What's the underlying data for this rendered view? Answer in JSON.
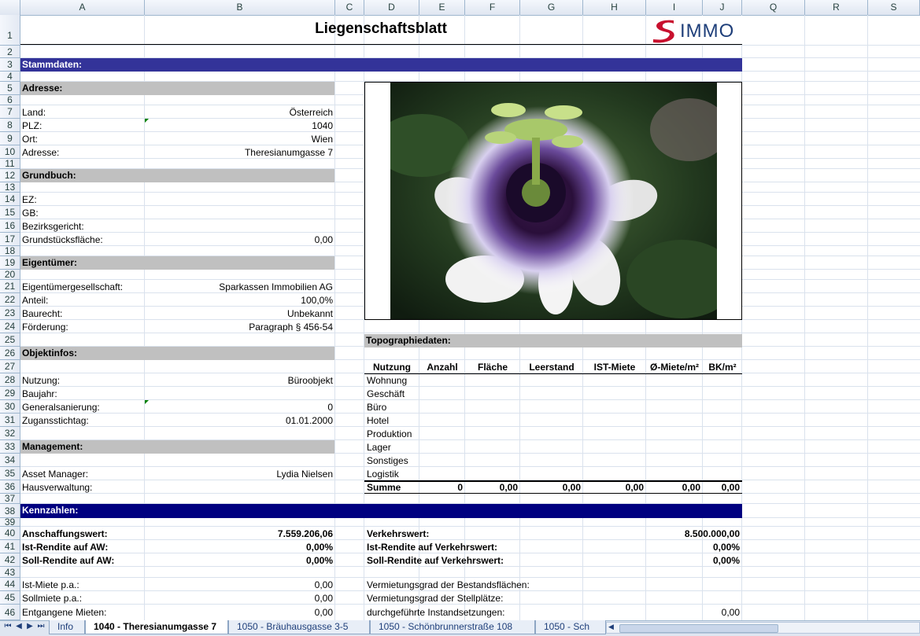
{
  "columns": [
    "A",
    "B",
    "C",
    "D",
    "E",
    "F",
    "G",
    "H",
    "I",
    "J",
    "Q",
    "R",
    "S"
  ],
  "rows": [
    "1",
    "2",
    "3",
    "4",
    "5",
    "6",
    "7",
    "8",
    "9",
    "10",
    "11",
    "12",
    "13",
    "14",
    "15",
    "16",
    "17",
    "18",
    "19",
    "20",
    "21",
    "22",
    "23",
    "24",
    "25",
    "26",
    "27",
    "28",
    "29",
    "30",
    "31",
    "32",
    "33",
    "34",
    "35",
    "36",
    "37",
    "38",
    "39",
    "40",
    "41",
    "42",
    "43",
    "44",
    "45",
    "46"
  ],
  "title": "Liegenschaftsblatt",
  "logo": {
    "text": "IMMO",
    "color_red": "#c8102e",
    "color_blue": "#1f3f7a"
  },
  "sections": {
    "stammdaten": "Stammdaten:",
    "adresse": "Adresse:",
    "grundbuch": "Grundbuch:",
    "eigentuemer": "Eigentümer:",
    "objektinfos": "Objektinfos:",
    "management": "Management:",
    "topographie": "Topographiedaten:",
    "kennzahlen": "Kennzahlen:"
  },
  "adresse": [
    {
      "label": "Land:",
      "value": "Österreich"
    },
    {
      "label": "PLZ:",
      "value": "1040"
    },
    {
      "label": "Ort:",
      "value": "Wien"
    },
    {
      "label": "Adresse:",
      "value": "Theresianumgasse 7"
    }
  ],
  "grundbuch": [
    {
      "label": "EZ:",
      "value": ""
    },
    {
      "label": "GB:",
      "value": ""
    },
    {
      "label": "Bezirksgericht:",
      "value": ""
    },
    {
      "label": "Grundstücksfläche:",
      "value": "0,00"
    }
  ],
  "eigentuemer": [
    {
      "label": "Eigentümergesellschaft:",
      "value": "Sparkassen Immobilien AG"
    },
    {
      "label": "Anteil:",
      "value": "100,0%"
    },
    {
      "label": "Baurecht:",
      "value": "Unbekannt"
    },
    {
      "label": "Förderung:",
      "value": "Paragraph § 456-54"
    }
  ],
  "objektinfos": [
    {
      "label": "Nutzung:",
      "value": "Büroobjekt"
    },
    {
      "label": "Baujahr:",
      "value": ""
    },
    {
      "label": "Generalsanierung:",
      "value": "0"
    },
    {
      "label": "Zugansstichtag:",
      "value": "01.01.2000"
    }
  ],
  "management": [
    {
      "label": "Asset Manager:",
      "value": "Lydia Nielsen"
    },
    {
      "label": "Hausverwaltung:",
      "value": ""
    }
  ],
  "topo": {
    "headers": [
      "Nutzung",
      "Anzahl",
      "Fläche",
      "Leerstand",
      "IST-Miete",
      "Ø-Miete/m²",
      "BK/m²"
    ],
    "rows": [
      "Wohnung",
      "Geschäft",
      "Büro",
      "Hotel",
      "Produktion",
      "Lager",
      "Sonstiges",
      "Logistik"
    ],
    "summe": {
      "label": "Summe",
      "values": [
        "0",
        "0,00",
        "0,00",
        "0,00",
        "0,00",
        "0,00"
      ]
    }
  },
  "kennzahlen_left": [
    {
      "label": "Anschaffungswert:",
      "value": "7.559.206,06",
      "bold": true
    },
    {
      "label": "Ist-Rendite auf AW:",
      "value": "0,00%",
      "bold": true
    },
    {
      "label": "Soll-Rendite auf AW:",
      "value": "0,00%",
      "bold": true
    },
    {
      "label": "Ist-Miete p.a.:",
      "value": "0,00",
      "bold": false
    },
    {
      "label": "Sollmiete p.a.:",
      "value": "0,00",
      "bold": false
    },
    {
      "label": "Entgangene Mieten:",
      "value": "0,00",
      "bold": false
    }
  ],
  "kennzahlen_right": [
    {
      "label": "Verkehrswert:",
      "value": "8.500.000,00",
      "bold": true
    },
    {
      "label": "Ist-Rendite auf Verkehrswert:",
      "value": "0,00%",
      "bold": true
    },
    {
      "label": "Soll-Rendite auf Verkehrswert:",
      "value": "0,00%",
      "bold": true
    },
    {
      "label": "Vermietungsgrad der Bestandsflächen:",
      "value": "",
      "bold": false
    },
    {
      "label": "Vermietungsgrad der Stellplätze:",
      "value": "",
      "bold": false
    },
    {
      "label": "durchgeführte Instandsetzungen:",
      "value": "0,00",
      "bold": false
    }
  ],
  "tabs": [
    "Info",
    "1040 - Theresianumgasse 7",
    "1050 - Bräuhausgasse 3-5",
    "1050 - Schönbrunnerstraße 108",
    "1050 - Sch"
  ],
  "active_tab": 1,
  "colors": {
    "header_blue": "#333399",
    "header_navy": "#000080",
    "section_gray": "#c0c0c0"
  }
}
